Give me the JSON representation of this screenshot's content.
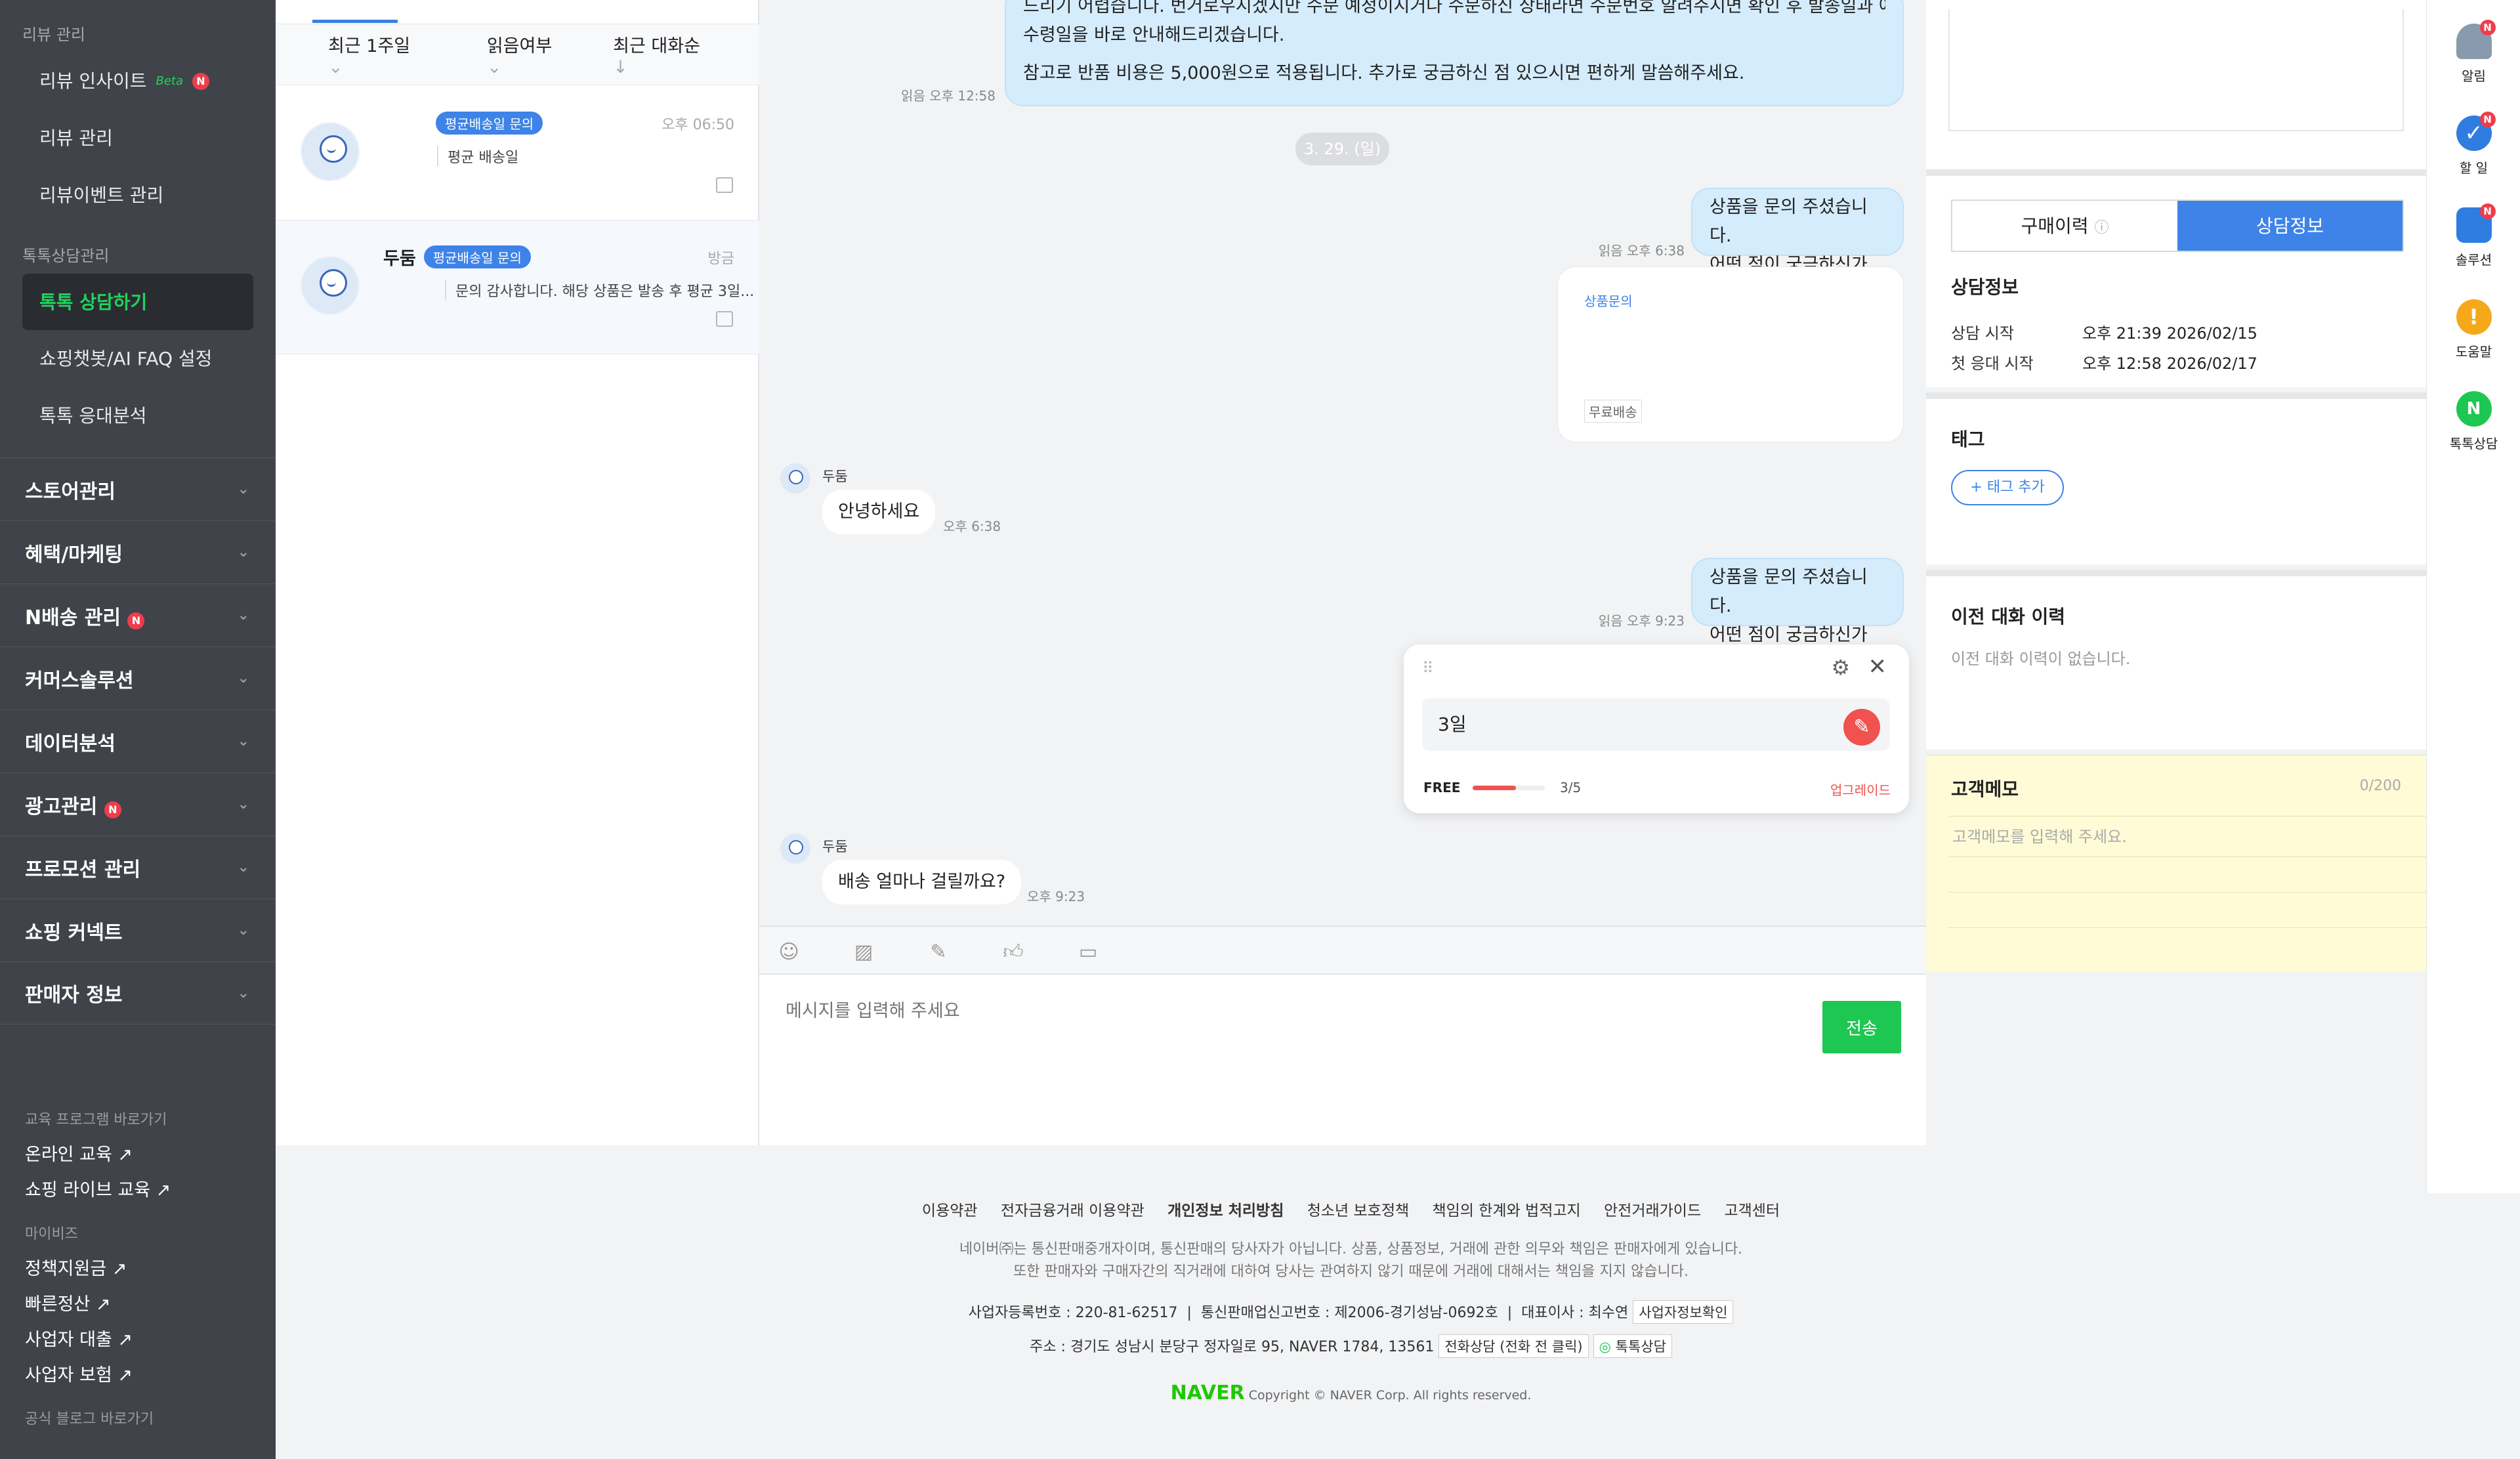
{
  "sidebar": {
    "review_section": "리뷰 관리",
    "review_items": [
      "리뷰 인사이트",
      "리뷰 관리",
      "리뷰이벤트 관리"
    ],
    "beta_label": "Beta",
    "talk_section": "톡톡상담관리",
    "talk_items": [
      "톡톡 상담하기",
      "쇼핑챗봇/AI FAQ 설정",
      "톡톡 응대분석"
    ],
    "groups": [
      "스토어관리",
      "혜택/마케팅",
      "N배송 관리",
      "커머스솔루션",
      "데이터분석",
      "광고관리",
      "프로모션 관리",
      "쇼핑 커넥트",
      "판매자 정보"
    ],
    "edu_section": "교육 프로그램 바로가기",
    "edu_links": [
      "온라인 교육 ↗",
      "쇼핑 라이브 교육 ↗"
    ],
    "mybiz_section": "마이비즈",
    "mybiz_links": [
      "정책지원금 ↗",
      "빠른정산 ↗",
      "사업자 대출 ↗",
      "사업자 보험 ↗"
    ],
    "blog_section": "공식 블로그 바로가기",
    "badge": "N"
  },
  "list": {
    "filter_period": "최근 1주일",
    "filter_read": "읽음여부",
    "sort": "최근 대화순",
    "conversations": [
      {
        "name": "",
        "tag": "평균배송일 문의",
        "time": "오후 06:50",
        "preview": "평균 배송일"
      },
      {
        "name": "두둠",
        "tag": "평균배송일 문의",
        "time": "방금",
        "preview": "문의 감사합니다. 해당 상품은 발송 후 평균 3일..."
      }
    ]
  },
  "chat": {
    "msg1_line1": "드리기 어렵습니다. 번거로우시겠지만 수문 예정이시거나 수문하신 상태라면 수문번호 알려주시면 확인 후 발송일과 예상",
    "msg1_line2": "수령일을 바로 안내해드리겠습니다.",
    "msg1_line3": "참고로 반품 비용은 5,000원으로 적용됩니다. 추가로 궁금하신 점 있으시면 편하게 말씀해주세요.",
    "msg1_meta": "읽음 오후 12:58",
    "date_divider": "3. 29. (일)",
    "msg2_line1": "상품을 문의 주셨습니다.",
    "msg2_line2": "어떤 점이 궁금하신가요?",
    "msg2_meta": "읽음 오후 6:38",
    "card_tag": "상품문의",
    "card_small": "무료배송",
    "in1_name": "두둠",
    "in1_text": "안녕하세요",
    "in1_time": "오후 6:38",
    "msg3_line1": "상품을 문의 주셨습니다.",
    "msg3_line2": "어떤 점이 궁금하신가요?",
    "msg3_meta": "읽음 오후 9:23",
    "in2_name": "두둠",
    "in2_text": "배송 얼마나 걸릴까요?",
    "in2_time": "오후 9:23",
    "macro_input": "3일",
    "macro_plan": "FREE",
    "macro_count": "3/5",
    "macro_progress": 0.6,
    "macro_upgrade": "업그레이드"
  },
  "composer": {
    "placeholder": "메시지를 입력해 주세요",
    "send": "전송"
  },
  "right": {
    "tab_purchase": "구매이력",
    "tab_info": "상담정보",
    "info_title": "상담정보",
    "start_label": "상담 시작",
    "start_value": "오후 21:39 2026/02/15",
    "first_label": "첫 응대 시작",
    "first_value": "오후 12:58 2026/02/17",
    "tag_title": "태그",
    "tag_add": "+ 태그 추가",
    "history_title": "이전 대화 이력",
    "history_empty": "이전 대화 이력이 없습니다.",
    "memo_title": "고객메모",
    "memo_count": "0/200",
    "memo_placeholder": "고객메모를 입력해 주세요."
  },
  "rail": {
    "items": [
      "알림",
      "할 일",
      "솔루션",
      "도움말",
      "톡톡상담"
    ],
    "badge": "N"
  },
  "footer": {
    "links": [
      "이용약관",
      "전자금융거래 이용약관",
      "개인정보 처리방침",
      "청소년 보호정책",
      "책임의 한계와 법적고지",
      "안전거래가이드",
      "고객센터"
    ],
    "notice1": "네이버㈜는 통신판매중개자이며, 통신판매의 당사자가 아닙니다. 상품, 상품정보, 거래에 관한 의무와 책임은 판매자에게 있습니다.",
    "notice2": "또한 판매자와 구매자간의 직거래에 대하여 당사는 관여하지 않기 때문에 거래에 대해서는 책임을 지지 않습니다.",
    "biz_no": "사업자등록번호 : 220-81-62517",
    "sales_no": "통신판매업신고번호 : 제2006-경기성남-0692호",
    "ceo": "대표이사 : 최수연",
    "biz_check": "사업자정보확인",
    "address": "주소 : 경기도 성남시 분당구 정자일로 95, NAVER 1784, 13561",
    "phone": "전화상담 (전화 전 클릭)",
    "talk": "톡톡상담",
    "logo": "NAVER",
    "copyright": "Copyright © NAVER Corp. All rights reserved."
  },
  "colors": {
    "accent": "#3d83e8",
    "green": "#1ec752",
    "sidebar": "#41434b"
  }
}
